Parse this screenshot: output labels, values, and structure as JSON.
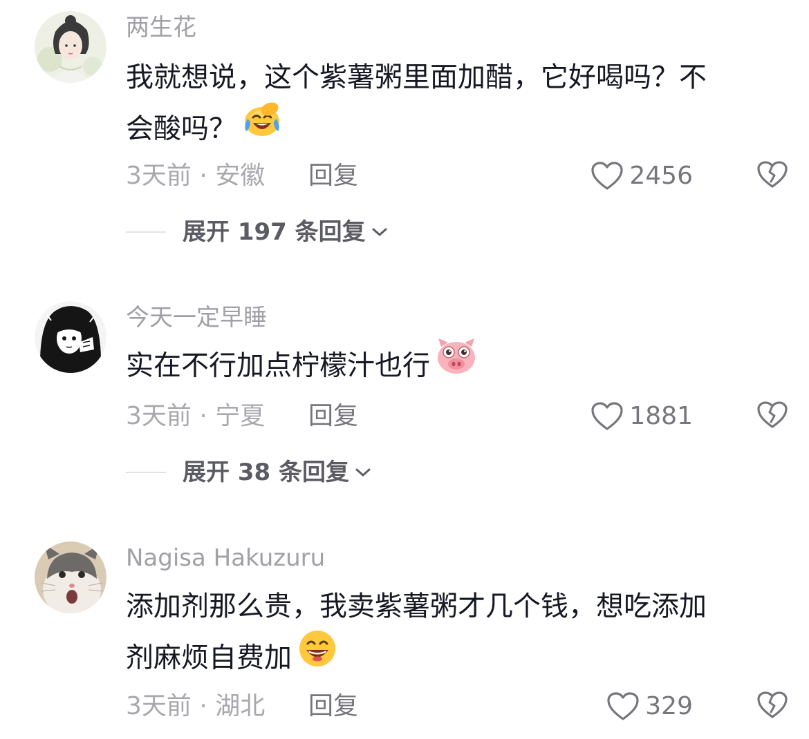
{
  "comments": [
    {
      "username": "两生花",
      "text_line1": "我就想说，这个紫薯粥里面加醋，它好喝吗？不",
      "text_line2": "会酸吗？",
      "emoji": "laughing-crying-emoji",
      "time_location": "3天前 · 安徽",
      "reply_label": "回复",
      "likes": "2456",
      "expand_label": "展开 197 条回复"
    },
    {
      "username": "今天一定早睡",
      "text_line1": "实在不行加点柠檬汁也行",
      "emoji": "pig-face-emoji",
      "time_location": "3天前 · 宁夏",
      "reply_label": "回复",
      "likes": "1881",
      "expand_label": "展开 38 条回复"
    },
    {
      "username": "Nagisa Hakuzuru",
      "text_line1": "添加剂那么贵，我卖紫薯粥才几个钱，想吃添加",
      "text_line2": "剂麻烦自费加",
      "emoji": "grinning-emoji",
      "time_location": "3天前 · 湖北",
      "reply_label": "回复",
      "likes": "329"
    }
  ],
  "icons": {
    "like": "heart-outline-icon",
    "dislike": "broken-heart-icon",
    "expand": "chevron-down-icon"
  },
  "colors": {
    "username": "#a0a0a6",
    "body": "#161823",
    "meta": "#a8a8ad",
    "action": "#76767c"
  }
}
